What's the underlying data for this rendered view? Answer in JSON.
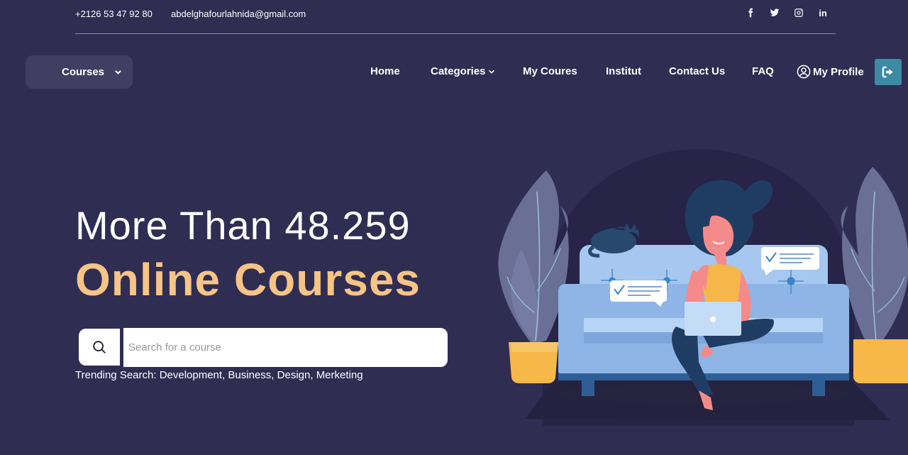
{
  "topbar": {
    "phone": "+2126 53 47 92 80",
    "email": "abdelghafourlahnida@gmail.com",
    "social": [
      "facebook-icon",
      "twitter-icon",
      "instagram-icon",
      "linkedin-icon"
    ],
    "linkedin_text": "in"
  },
  "nav": {
    "courses_button": "Courses",
    "items": [
      "Home",
      "Categories",
      "My Coures",
      "Institut",
      "Contact Us",
      "FAQ",
      "My Profile"
    ]
  },
  "hero": {
    "line1": "More Than 48.259",
    "line2": "Online Courses"
  },
  "search": {
    "placeholder": "Search for a course"
  },
  "trending": {
    "label": "Trending Search:",
    "links": [
      "Development",
      "Business",
      "Design",
      "Merketing"
    ]
  },
  "colors": {
    "background": "#302d52",
    "accent": "#f6c486",
    "logout": "#3d8aa4"
  }
}
